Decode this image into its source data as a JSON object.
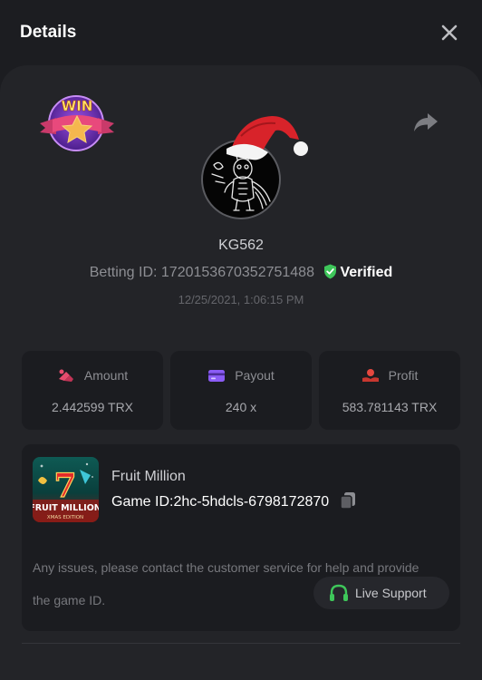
{
  "header": {
    "title": "Details",
    "close_icon": "close-icon"
  },
  "badge": {
    "text": "WIN"
  },
  "user": {
    "username": "KG562",
    "betting_id_label": "Betting ID:",
    "betting_id": "1720153670352751488",
    "verified_label": "Verified",
    "date": "12/25/2021, 1:06:15 PM"
  },
  "stats": [
    {
      "label": "Amount",
      "value": "2.442599 TRX",
      "icon": "amount-icon",
      "color": "#e74c6e"
    },
    {
      "label": "Payout",
      "value": "240 x",
      "icon": "payout-card-icon",
      "color": "#8b5cf6"
    },
    {
      "label": "Profit",
      "value": "583.781143 TRX",
      "icon": "profit-icon",
      "color": "#e5483f"
    }
  ],
  "game": {
    "name": "Fruit Million",
    "id_label": "Game ID:",
    "id": "2hc-5hdcls-6798172870",
    "thumb_title": "FRUIT MILLION",
    "thumb_subtitle": "XMAS EDITION",
    "thumb_number": "7"
  },
  "support": {
    "help_text": "Any issues, please contact the customer service for help and provide the game ID.",
    "button_label": "Live Support"
  },
  "colors": {
    "background": "#1c1d21",
    "panel": "#232428",
    "card": "#1b1c20",
    "verified": "#3ec65a",
    "support_icon": "#3ec65a"
  }
}
